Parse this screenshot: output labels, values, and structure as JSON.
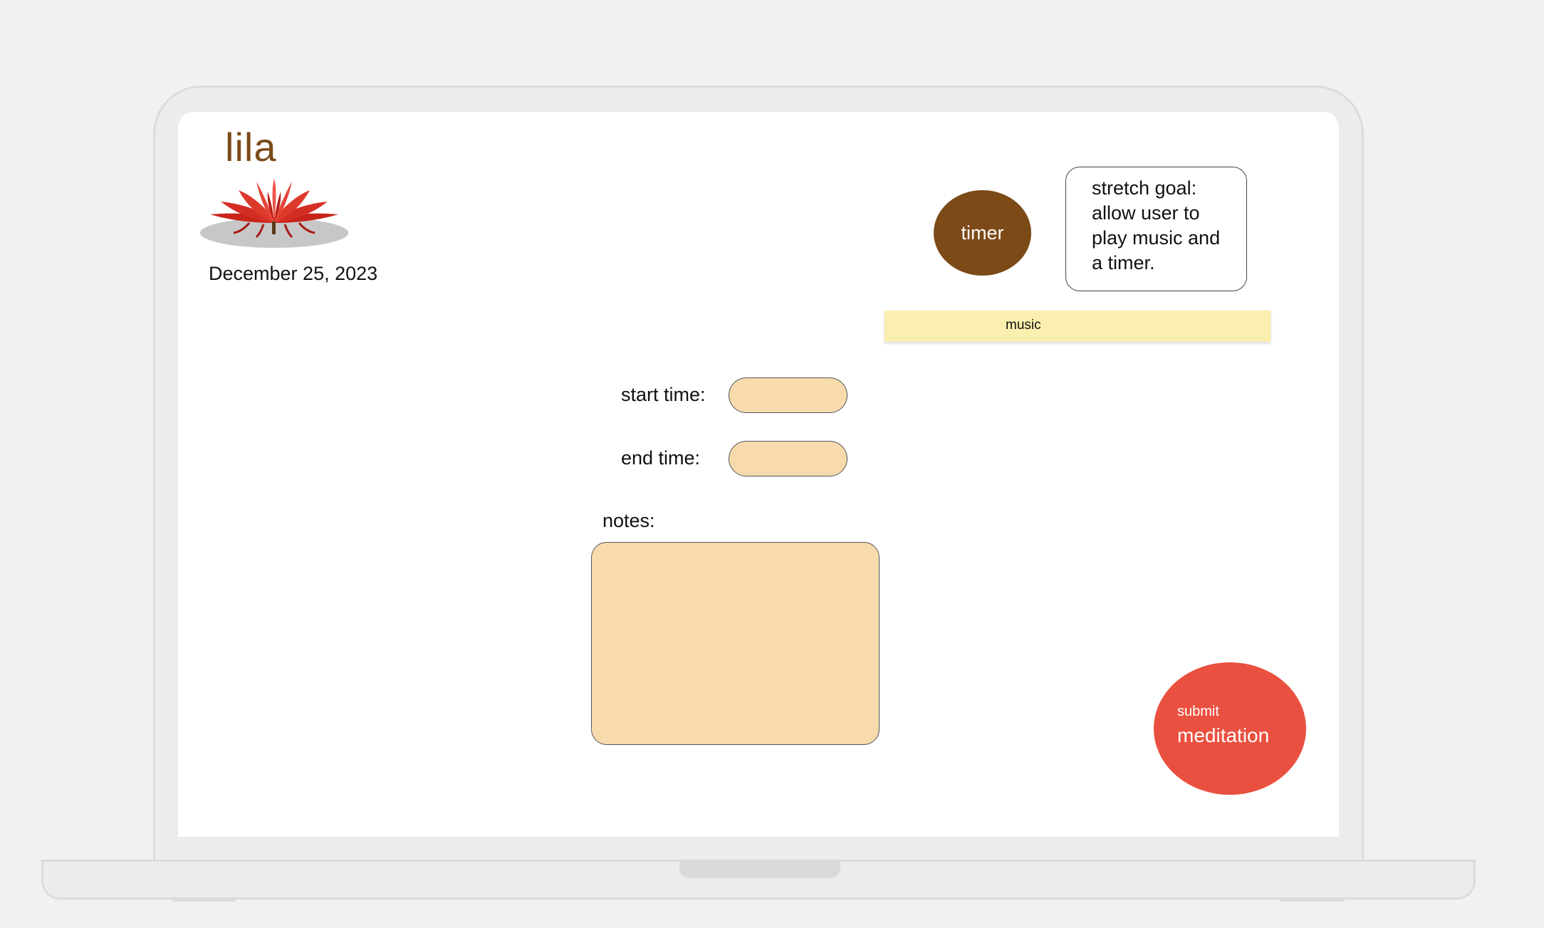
{
  "app": {
    "logo_text": "lila",
    "date": "December 25, 2023"
  },
  "timer": {
    "label": "timer"
  },
  "stretch_note": {
    "lines": [
      "stretch goal:",
      "allow user to",
      "play music and",
      "a timer."
    ]
  },
  "music": {
    "label": "music"
  },
  "form": {
    "start_label": "start time:",
    "end_label": "end time:",
    "notes_label": "notes:",
    "start_value": "",
    "end_value": "",
    "notes_value": ""
  },
  "submit": {
    "small_label": "submit",
    "big_label": "meditation"
  },
  "colors": {
    "brand_brown": "#7b4a17",
    "field_fill": "#f7dbad",
    "music_bar": "#fbefaf",
    "submit_red": "#ea503f"
  },
  "icons": {
    "logo": "lotus-flower-icon"
  }
}
